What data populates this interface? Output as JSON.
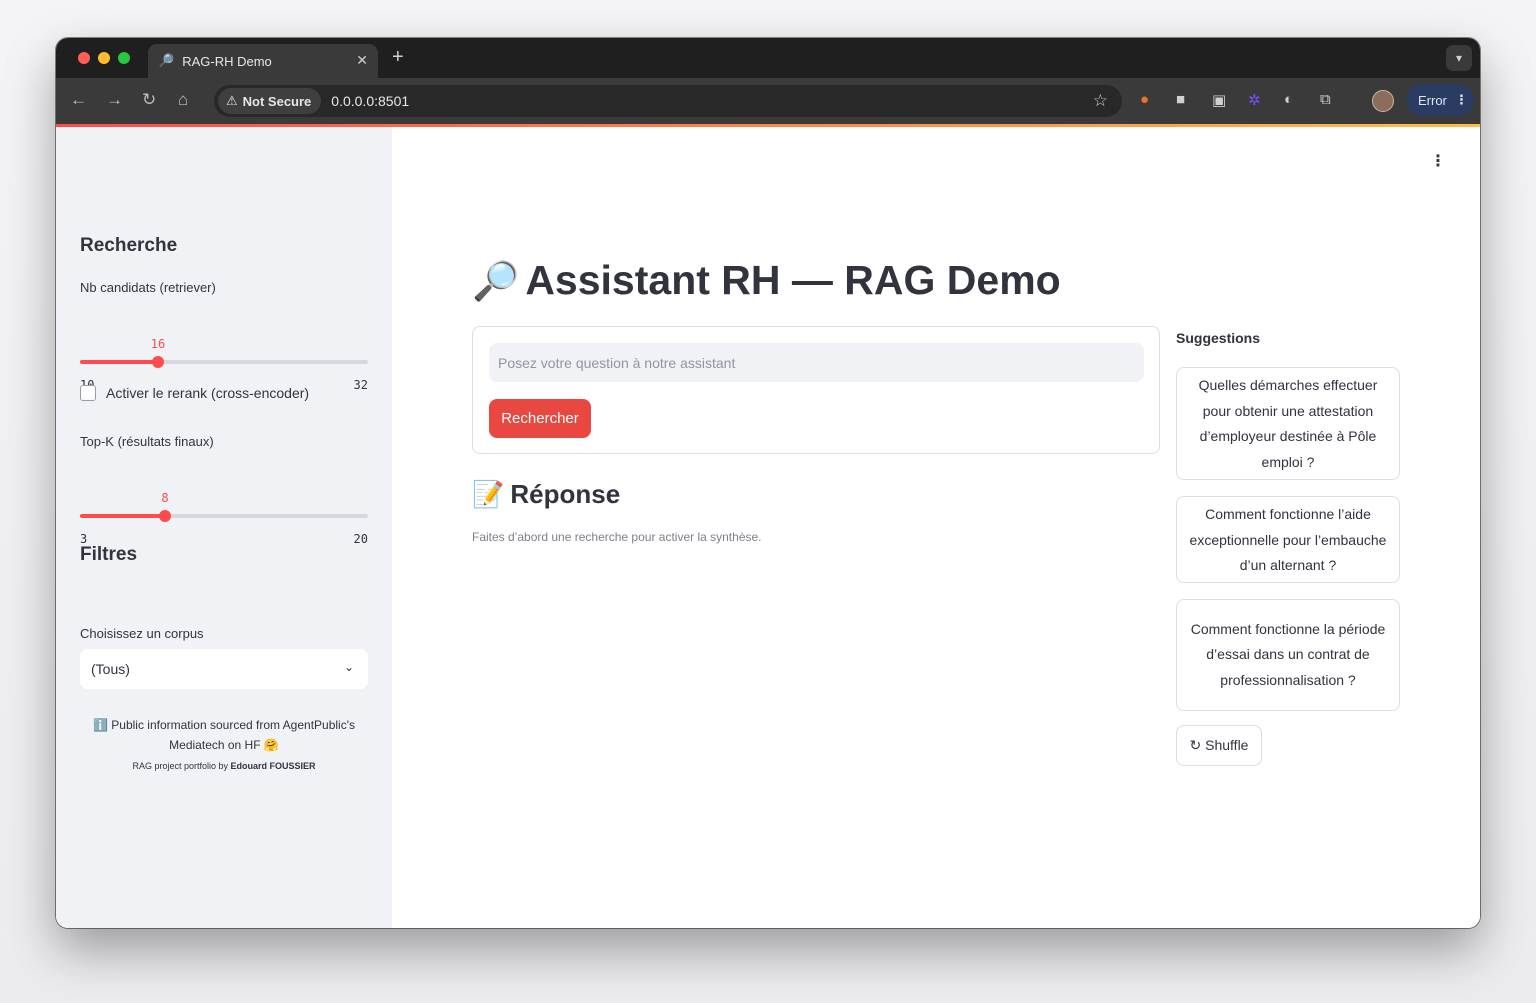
{
  "browser": {
    "tab_title": "RAG-RH Demo",
    "tab_favicon": "🔎",
    "tab_close": "✕",
    "new_tab": "+",
    "security_chip": "Not Secure",
    "url": "0.0.0.0:8501",
    "profile_button": "Error"
  },
  "sidebar": {
    "search_heading": "Recherche",
    "candidates_label": "Nb candidats (retriever)",
    "candidates_slider": {
      "value": "16",
      "min": "10",
      "max": "32"
    },
    "rerank_label": "Activer le rerank (cross-encoder)",
    "rerank_checked": false,
    "topk_label": "Top-K (résultats finaux)",
    "topk_slider": {
      "value": "8",
      "min": "3",
      "max": "20"
    },
    "filters_heading": "Filtres",
    "corpus_label": "Choisissez un corpus",
    "corpus_selected": "(Tous)",
    "note_icon": "ℹ️",
    "note_text": "Public information sourced from AgentPublic's Mediatech on HF 🤗",
    "credit_prefix": "RAG project portfolio by ",
    "credit_author": "Edouard FOUSSIER"
  },
  "main": {
    "title_icon": "🔎",
    "title": "Assistant RH — RAG Demo",
    "question_placeholder": "Posez votre question à notre assistant",
    "search_button": "Rechercher",
    "response_icon": "📝",
    "response_heading": "Réponse",
    "response_hint": "Faites d’abord une recherche pour activer la synthèse.",
    "suggestions_heading": "Suggestions",
    "suggestions": [
      "Quelles démarches effectuer pour obtenir une attestation d’employeur destinée à Pôle emploi ?",
      "Comment fonctionne l’aide exceptionnelle pour l’embauche d’un alternant ?",
      "Comment fonctionne la période d’essai dans un contrat de professionnalisation ?"
    ],
    "shuffle_button": "↻ Shuffle"
  },
  "colors": {
    "accent": "#ff4b4b",
    "sidebar_bg": "#f0f2f6",
    "text": "#31333f"
  },
  "icons": [
    "back-arrow-icon",
    "forward-arrow-icon",
    "reload-icon",
    "home-icon",
    "warning-icon",
    "bookmark-star-icon",
    "extensions-icon",
    "kebab-menu-icon",
    "chevron-down-icon"
  ]
}
